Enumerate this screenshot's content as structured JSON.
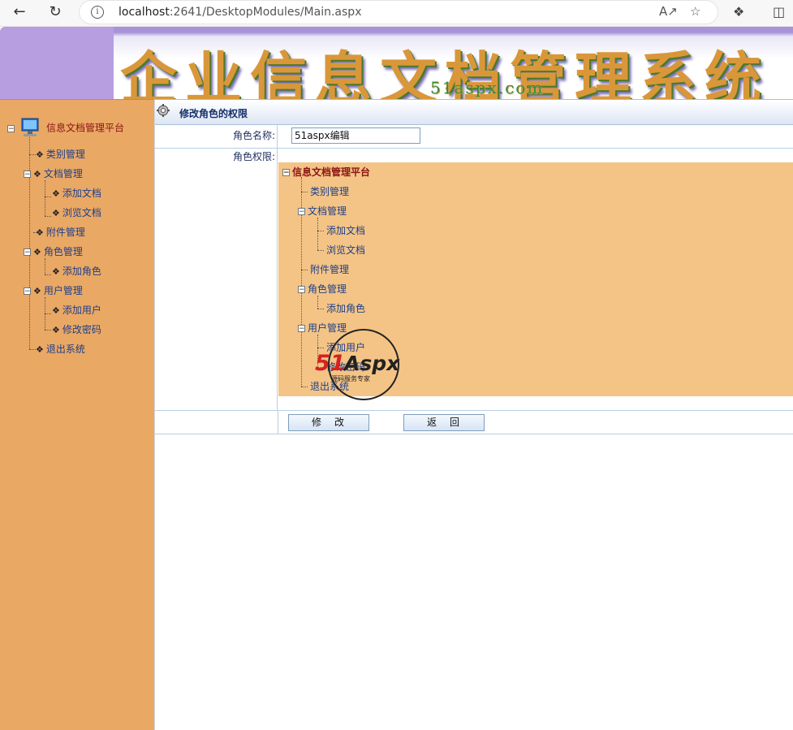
{
  "browser": {
    "url_host": "localhost",
    "url_rest": ":2641/DesktopModules/Main.aspx"
  },
  "banner": {
    "title": "企业信息文档管理系统",
    "site": "51aspx.com"
  },
  "nav": {
    "root": "信息文档管理平台",
    "items": [
      {
        "label": "类别管理"
      },
      {
        "label": "文档管理"
      },
      {
        "label": "添加文档"
      },
      {
        "label": "浏览文档"
      },
      {
        "label": "附件管理"
      },
      {
        "label": "角色管理"
      },
      {
        "label": "添加角色"
      },
      {
        "label": "用户管理"
      },
      {
        "label": "添加用户"
      },
      {
        "label": "修改密码"
      },
      {
        "label": "退出系统"
      }
    ]
  },
  "page": {
    "header": "修改角色的权限",
    "role_name_label": "角色名称:",
    "role_name_value": "51aspx编辑",
    "permissions_label": "角色权限:",
    "modify_button": "修　改",
    "return_button": "返　回"
  },
  "permissions": {
    "root": "信息文档管理平台",
    "items": [
      {
        "label": "类别管理"
      },
      {
        "label": "文档管理"
      },
      {
        "label": "添加文档"
      },
      {
        "label": "浏览文档"
      },
      {
        "label": "附件管理"
      },
      {
        "label": "角色管理"
      },
      {
        "label": "添加角色"
      },
      {
        "label": "用户管理"
      },
      {
        "label": "添加用户"
      },
      {
        "label": "修改密码"
      },
      {
        "label": "退出系统"
      }
    ]
  },
  "watermark": {
    "logo": "51Aspx",
    "tagline": "源码服务专家"
  }
}
